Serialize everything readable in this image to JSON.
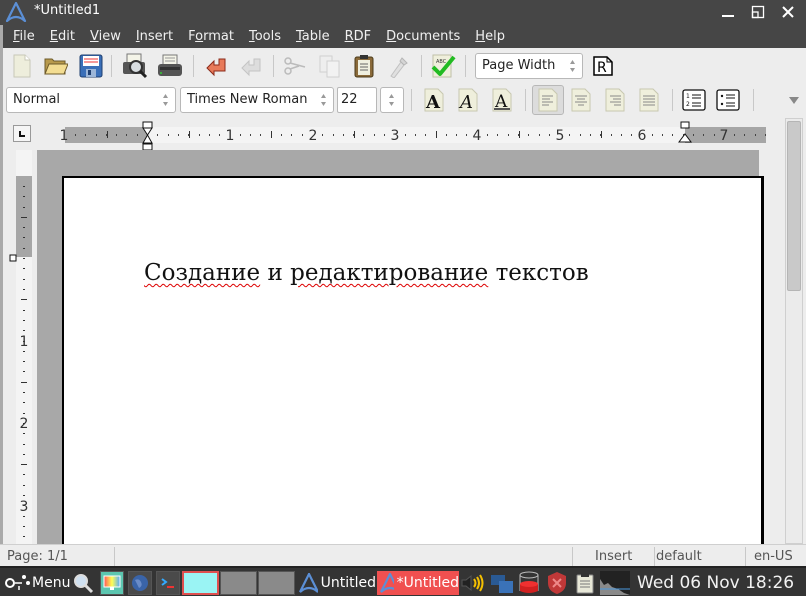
{
  "window": {
    "title": "*Untitled1",
    "controls": {
      "minimize": "minimize",
      "maximize": "restore",
      "close": "close"
    }
  },
  "menu": [
    {
      "label": "File",
      "mnemonic": "F",
      "rest": "ile"
    },
    {
      "label": "Edit",
      "mnemonic": "E",
      "rest": "dit"
    },
    {
      "label": "View",
      "mnemonic": "V",
      "rest": "iew"
    },
    {
      "label": "Insert",
      "mnemonic": "I",
      "rest": "nsert"
    },
    {
      "label": "Format",
      "pre": "F",
      "mnemonic": "o",
      "rest": "rmat"
    },
    {
      "label": "Tools",
      "mnemonic": "T",
      "rest": "ools"
    },
    {
      "label": "Table",
      "mnemonic": "T",
      "rest": "able"
    },
    {
      "label": "RDF",
      "mnemonic": "R",
      "rest": "DF"
    },
    {
      "label": "Documents",
      "mnemonic": "D",
      "rest": "ocuments"
    },
    {
      "label": "Help",
      "mnemonic": "H",
      "rest": "elp"
    }
  ],
  "toolbar": {
    "buttons": [
      "new-document",
      "open-folder",
      "save",
      "print-preview",
      "print",
      "undo",
      "redo",
      "cut",
      "copy",
      "paste",
      "format-painter",
      "spellcheck"
    ],
    "zoom_value": "Page Width",
    "revisions_label": "R"
  },
  "format_toolbar": {
    "style_value": "Normal",
    "font_value": "Times New Roman",
    "size_value": "22",
    "bold_glyph": "A",
    "italic_glyph": "A",
    "underline_glyph": "A",
    "numbered_list_nums": [
      "1",
      "2"
    ]
  },
  "ruler": {
    "horizontal_labels": [
      "1",
      "1",
      "2",
      "3",
      "4",
      "5",
      "6",
      "7"
    ],
    "vertical_labels": [
      "1",
      "2",
      "3"
    ],
    "tab_type": "left-tab"
  },
  "document": {
    "words": [
      {
        "text": "Создание",
        "misspelled": true
      },
      {
        "text": "и",
        "misspelled": false
      },
      {
        "text": "редактирование",
        "misspelled": true
      },
      {
        "text": "текстов",
        "misspelled": false
      }
    ]
  },
  "statusbar": {
    "page": "Page: 1/1",
    "message": "",
    "mode": "Insert",
    "style": "default",
    "language": "en-US"
  },
  "taskbar": {
    "menu_label": "Menu",
    "tasks": [
      {
        "label": "Untitled",
        "active": false
      },
      {
        "label": "*Untitled",
        "active": true
      }
    ],
    "clock": "Wed 06 Nov 18:26",
    "colors": {
      "active_task": "#f05050",
      "workspace_active": "#9af4f4"
    }
  }
}
